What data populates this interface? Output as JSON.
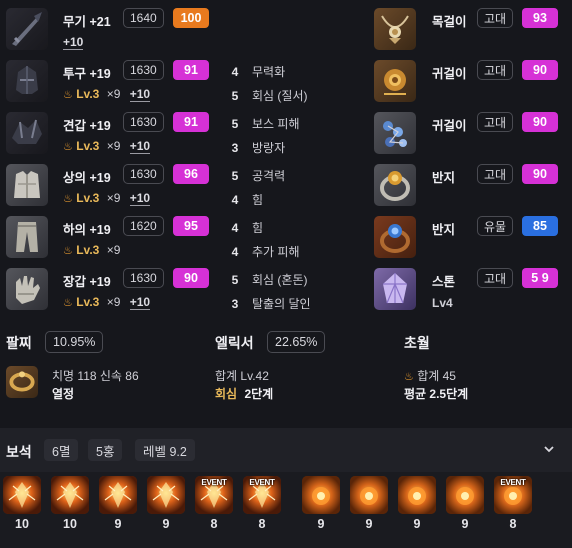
{
  "colors": {
    "magenta_badge": "#d631d6",
    "orange_badge": "#e87a1e",
    "blue_badge": "#2a6fe0",
    "background": "#16171c"
  },
  "equipment": {
    "weapon": {
      "icon": "sword-icon",
      "name": "무기 +21",
      "item_level": "1640",
      "quality": "100",
      "plus": "+10"
    },
    "helmet": {
      "icon": "helmet-icon",
      "name": "투구 +19",
      "item_level": "1630",
      "quality": "91",
      "lv": "Lv.3",
      "x": "×9",
      "plus": "+10"
    },
    "shoulder": {
      "icon": "shoulder-icon",
      "name": "견갑 +19",
      "item_level": "1630",
      "quality": "91",
      "lv": "Lv.3",
      "x": "×9",
      "plus": "+10"
    },
    "chest": {
      "icon": "chest-armor-icon",
      "name": "상의 +19",
      "item_level": "1630",
      "quality": "96",
      "lv": "Lv.3",
      "x": "×9",
      "plus": "+10"
    },
    "pants": {
      "icon": "pants-icon",
      "name": "하의 +19",
      "item_level": "1620",
      "quality": "95",
      "lv": "Lv.3",
      "x": "×9"
    },
    "gloves": {
      "icon": "gauntlet-icon",
      "name": "장갑 +19",
      "item_level": "1630",
      "quality": "90",
      "lv": "Lv.3",
      "x": "×9",
      "plus": "+10"
    }
  },
  "engravings": [
    {
      "level": "4",
      "name": "무력화"
    },
    {
      "level": "5",
      "name": "회심 (질서)"
    },
    {
      "level": "5",
      "name": "보스 피해"
    },
    {
      "level": "3",
      "name": "방랑자"
    },
    {
      "level": "5",
      "name": "공격력"
    },
    {
      "level": "4",
      "name": "힘"
    },
    {
      "level": "4",
      "name": "힘"
    },
    {
      "level": "4",
      "name": "추가 피해"
    },
    {
      "level": "5",
      "name": "회심 (혼돈)"
    },
    {
      "level": "3",
      "name": "탈출의 달인"
    }
  ],
  "accessories": [
    {
      "icon": "necklace-icon",
      "name": "목걸이",
      "grade": "고대",
      "quality": "93"
    },
    {
      "icon": "earring-icon",
      "name": "귀걸이",
      "grade": "고대",
      "quality": "90"
    },
    {
      "icon": "earring-icon",
      "name": "귀걸이",
      "grade": "고대",
      "quality": "90"
    },
    {
      "icon": "ring-icon",
      "name": "반지",
      "grade": "고대",
      "quality": "90"
    },
    {
      "icon": "ring-icon",
      "name": "반지",
      "grade": "유물",
      "quality": "85"
    },
    {
      "icon": "stone-icon",
      "name": "스톤",
      "grade": "고대",
      "quality": "5 9",
      "sub": "Lv4"
    }
  ],
  "bracelet": {
    "title": "팔찌",
    "percent": "10.95%",
    "stats": "치명 118  신속 86",
    "effect": "열정"
  },
  "elixir": {
    "title": "엘릭서",
    "percent": "22.65%",
    "total": "합계 Lv.42",
    "effect_name": "회심",
    "effect_stage": "2단계"
  },
  "transcend": {
    "title": "초월",
    "total": "합계 45",
    "average": "평균 2.5단계"
  },
  "gems": {
    "title": "보석",
    "pills": [
      "6멸",
      "5홍",
      "레벨 9.2"
    ],
    "items": [
      {
        "type": "doom",
        "level": "10",
        "event": ""
      },
      {
        "type": "doom",
        "level": "10",
        "event": ""
      },
      {
        "type": "doom",
        "level": "9",
        "event": ""
      },
      {
        "type": "doom",
        "level": "9",
        "event": ""
      },
      {
        "type": "doom",
        "level": "8",
        "event": "EVENT"
      },
      {
        "type": "doom",
        "level": "8",
        "event": "EVENT"
      },
      {
        "type": "flame",
        "level": "9",
        "event": ""
      },
      {
        "type": "flame",
        "level": "9",
        "event": ""
      },
      {
        "type": "flame",
        "level": "9",
        "event": ""
      },
      {
        "type": "flame",
        "level": "9",
        "event": ""
      },
      {
        "type": "flame",
        "level": "8",
        "event": "EVENT"
      }
    ]
  }
}
